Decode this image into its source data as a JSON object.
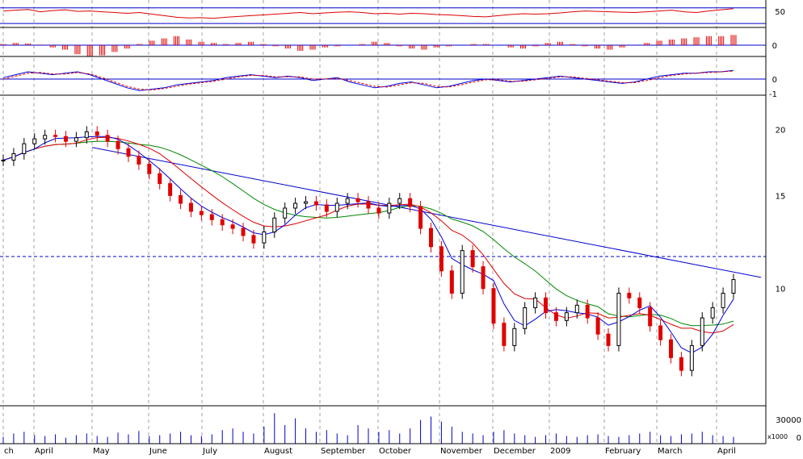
{
  "chart_data": {
    "type": "candlestick",
    "x_labels": [
      "ch",
      "April",
      "May",
      "June",
      "July",
      "August",
      "September",
      "October",
      "November",
      "December",
      "2009",
      "February",
      "March",
      "April"
    ],
    "colors": {
      "axis": "#000000",
      "reference_line": "#0000cc",
      "grid": "#a0a0a0",
      "up_candle": "#000000",
      "down_candle": "#e00000",
      "ma_short": "#0000dd",
      "ma_mid": "#dd0000",
      "ma_long": "#008800",
      "volume": "#0000cc",
      "rsi": "#dd0000",
      "macd_hist": "#dd0000",
      "osc_signal": "#dd0000"
    },
    "panels": {
      "rsi": {
        "ticks": [
          "50"
        ],
        "reference_lines": [
          70,
          30
        ],
        "values": [
          62,
          64,
          66,
          60,
          63,
          65,
          61,
          62,
          60,
          58,
          56,
          58,
          54,
          50,
          46,
          44,
          45,
          43,
          46,
          48,
          50,
          52,
          54,
          56,
          58,
          55,
          57,
          59,
          60,
          58,
          55,
          56,
          54,
          56,
          55,
          53,
          52,
          50,
          48,
          47,
          50,
          53,
          55,
          54,
          55,
          57,
          60,
          62,
          61,
          60,
          59,
          58,
          60,
          62,
          64,
          60,
          58,
          62,
          65,
          68
        ]
      },
      "macd_hist": {
        "ticks": [
          "0"
        ],
        "values": [
          0.1,
          0.2,
          0.15,
          0.05,
          -0.2,
          -0.4,
          -0.8,
          -1.0,
          -0.9,
          -0.6,
          -0.3,
          0.1,
          0.4,
          0.6,
          0.8,
          0.5,
          0.3,
          0.2,
          0.1,
          0.2,
          0.3,
          0.1,
          -0.1,
          -0.3,
          -0.5,
          -0.4,
          -0.2,
          -0.1,
          0.0,
          0.1,
          0.3,
          0.2,
          -0.1,
          -0.3,
          -0.4,
          -0.2,
          -0.1,
          0.0,
          0.1,
          0.1,
          0.0,
          -0.2,
          -0.3,
          -0.1,
          0.2,
          0.3,
          0.1,
          -0.1,
          -0.3,
          -0.4,
          -0.2,
          0.0,
          0.2,
          0.4,
          0.5,
          0.6,
          0.7,
          0.8,
          0.8,
          0.9
        ]
      },
      "oscillator": {
        "ticks": [
          "0",
          "-1"
        ],
        "line": [
          0.1,
          0.3,
          0.5,
          0.4,
          0.3,
          0.4,
          0.5,
          0.3,
          0.0,
          -0.3,
          -0.6,
          -0.8,
          -0.7,
          -0.6,
          -0.4,
          -0.3,
          -0.2,
          -0.1,
          0.1,
          0.2,
          0.3,
          0.2,
          0.1,
          0.2,
          0.1,
          -0.1,
          0.0,
          0.1,
          -0.2,
          -0.4,
          -0.6,
          -0.5,
          -0.3,
          -0.2,
          -0.4,
          -0.6,
          -0.5,
          -0.3,
          -0.1,
          0.0,
          -0.1,
          -0.2,
          -0.1,
          0.0,
          0.1,
          0.2,
          0.1,
          0.0,
          -0.1,
          -0.2,
          -0.3,
          -0.2,
          0.0,
          0.2,
          0.3,
          0.4,
          0.4,
          0.5,
          0.5,
          0.6
        ],
        "signal": [
          0.0,
          0.2,
          0.4,
          0.45,
          0.35,
          0.35,
          0.45,
          0.35,
          0.1,
          -0.2,
          -0.5,
          -0.7,
          -0.75,
          -0.65,
          -0.5,
          -0.35,
          -0.25,
          -0.15,
          0.0,
          0.15,
          0.25,
          0.25,
          0.15,
          0.15,
          0.15,
          0.0,
          0.0,
          0.05,
          -0.1,
          -0.3,
          -0.5,
          -0.55,
          -0.4,
          -0.25,
          -0.3,
          -0.5,
          -0.55,
          -0.4,
          -0.2,
          -0.05,
          -0.05,
          -0.15,
          -0.15,
          -0.05,
          0.05,
          0.15,
          0.15,
          0.05,
          -0.05,
          -0.15,
          -0.25,
          -0.25,
          -0.1,
          0.1,
          0.25,
          0.35,
          0.4,
          0.45,
          0.5,
          0.55
        ]
      },
      "price": {
        "ticks": [
          "20",
          "15",
          "10"
        ],
        "scale": "log",
        "reference_level": 11.5,
        "trendline": [
          [
            18.5,
            10.5
          ]
        ],
        "ohlc_close": [
          17.5,
          18.0,
          18.8,
          19.2,
          19.5,
          19.4,
          19.0,
          19.3,
          19.8,
          19.5,
          19.0,
          18.4,
          17.8,
          17.2,
          16.5,
          15.8,
          15.0,
          14.5,
          14.0,
          13.8,
          13.5,
          13.2,
          13.0,
          12.6,
          12.2,
          12.8,
          13.6,
          14.2,
          14.5,
          14.6,
          14.4,
          14.0,
          14.5,
          14.8,
          14.6,
          14.2,
          13.9,
          14.5,
          14.8,
          14.3,
          13.0,
          12.0,
          10.8,
          9.8,
          11.8,
          11.0,
          10.0,
          8.6,
          7.8,
          8.4,
          9.2,
          9.6,
          9.0,
          8.7,
          9.0,
          9.3,
          8.8,
          8.2,
          7.8,
          9.8,
          9.6,
          9.2,
          8.5,
          8.0,
          7.4,
          7.0,
          7.8,
          8.8,
          9.2,
          9.8,
          10.4
        ]
      },
      "volume": {
        "ticks": [
          "30000",
          "0"
        ],
        "unit": "x1000",
        "values": [
          8,
          12,
          14,
          10,
          9,
          11,
          7,
          10,
          12,
          9,
          8,
          13,
          11,
          15,
          9,
          10,
          12,
          14,
          10,
          9,
          11,
          16,
          18,
          14,
          12,
          20,
          36,
          22,
          30,
          18,
          14,
          16,
          12,
          10,
          22,
          18,
          14,
          16,
          12,
          18,
          28,
          32,
          26,
          20,
          14,
          12,
          10,
          14,
          16,
          12,
          10,
          8,
          10,
          12,
          9,
          8,
          10,
          11,
          9,
          8,
          10,
          12,
          14,
          10,
          9,
          11,
          12,
          14,
          10,
          9,
          8
        ]
      }
    }
  }
}
